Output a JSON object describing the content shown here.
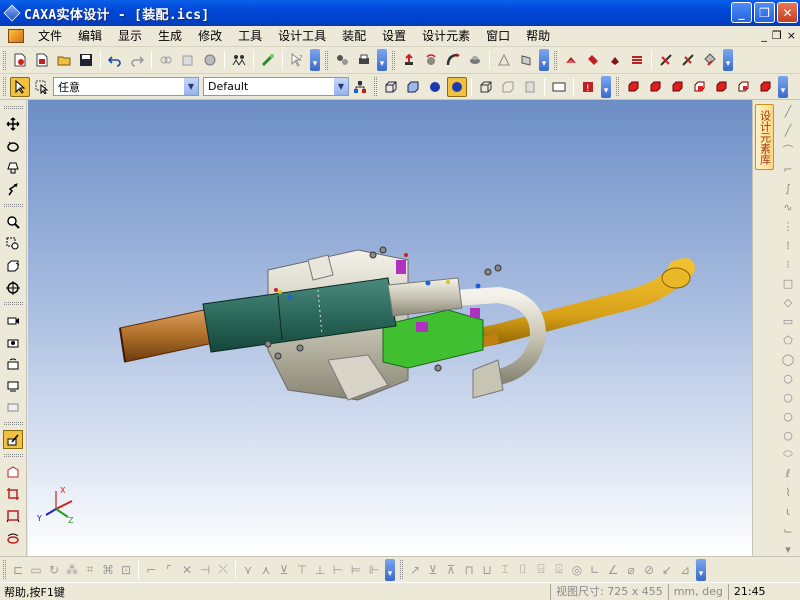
{
  "window": {
    "title": "CAXA实体设计 - [装配.ics]",
    "min": "_",
    "restore": "❐",
    "close": "✕"
  },
  "menu": {
    "items": [
      "文件",
      "编辑",
      "显示",
      "生成",
      "修改",
      "工具",
      "设计工具",
      "装配",
      "设置",
      "设计元素",
      "窗口",
      "帮助"
    ],
    "mdi": {
      "min": "_",
      "restore": "❐",
      "close": "×"
    }
  },
  "toolbar2": {
    "filter_value": "任意",
    "style_value": "Default"
  },
  "right_panel": {
    "tab_label": "设计元素库"
  },
  "triad": {
    "x": "X",
    "y": "Y",
    "z": "Z"
  },
  "status": {
    "help": "帮助,按F1键",
    "view_size": "视图尺寸: 725 x 455",
    "units": "mm, deg",
    "time": "21:45"
  },
  "colors": {
    "titlebar": "#0248d8",
    "teal_shaft": "#2c6a5c",
    "brass": "#b0702a",
    "gold_pipe": "#d8a018",
    "green_part": "#40c030",
    "magenta_part": "#b030c0"
  }
}
